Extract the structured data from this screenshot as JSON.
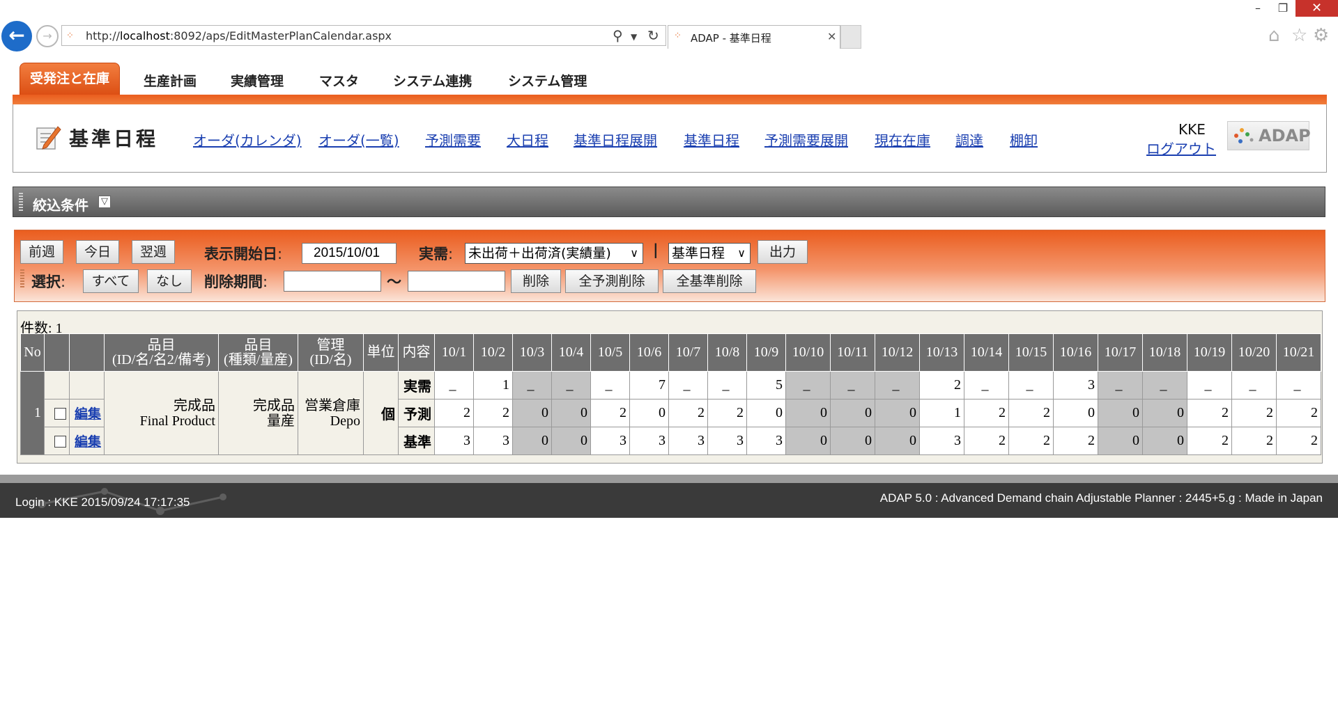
{
  "browser": {
    "url_prefix": "http://",
    "url_host": "localhost",
    "url_path": ":8092/aps/EditMasterPlanCalendar.aspx",
    "tab_title": "ADAP - 基準日程",
    "window_minimize": "–",
    "window_maximize": "❐",
    "window_close": "✕"
  },
  "menu": {
    "active": "受発注と在庫",
    "items": [
      "生産計画",
      "実績管理",
      "マスタ",
      "システム連携",
      "システム管理"
    ]
  },
  "header": {
    "page_title": "基準日程",
    "links": [
      "オーダ(カレンダ)",
      "オーダ(一覧)",
      "予測需要",
      "大日程",
      "基準日程展開",
      "基準日程",
      "予測需要展開",
      "現在在庫",
      "調達",
      "棚卸"
    ],
    "user": "KKE",
    "logout": "ログアウト",
    "logo": "ADAP"
  },
  "filter": {
    "title": "絞込条件",
    "toggle": "▽"
  },
  "controls": {
    "prev_week": "前週",
    "today": "今日",
    "next_week": "翌週",
    "start_date_label": "表示開始日",
    "start_date": "2015/10/01",
    "actual_label": "実需",
    "actual_select": "未出荷＋出荷済(実績量)",
    "separator": "|",
    "type_select": "基準日程",
    "output": "出力",
    "select_label": "選択",
    "select_all": "すべて",
    "select_none": "なし",
    "delete_period_label": "削除期間",
    "delete_from": "",
    "range_sep": "〜",
    "delete_to": "",
    "delete": "削除",
    "delete_all_forecast": "全予測削除",
    "delete_all_master": "全基準削除",
    "colon": ":"
  },
  "result": {
    "count_label": "件数",
    "count": "1",
    "headers": {
      "no": "No",
      "item_top": "品目",
      "item_sub": "(ID/名/名2/備考)",
      "item2_top": "品目",
      "item2_sub": "(種類/量産)",
      "mgmt_top": "管理",
      "mgmt_sub": "(ID/名)",
      "unit": "単位",
      "content": "内容"
    },
    "dates": [
      "10/1",
      "10/2",
      "10/3",
      "10/4",
      "10/5",
      "10/6",
      "10/7",
      "10/8",
      "10/9",
      "10/10",
      "10/11",
      "10/12",
      "10/13",
      "10/14",
      "10/15",
      "10/16",
      "10/17",
      "10/18",
      "10/19",
      "10/20",
      "10/21"
    ],
    "weekend": [
      false,
      false,
      true,
      true,
      false,
      false,
      false,
      false,
      false,
      true,
      true,
      true,
      false,
      false,
      false,
      false,
      true,
      true,
      false,
      false,
      false
    ],
    "row": {
      "no": "1",
      "edit": "編集",
      "item_name": "完成品",
      "item_name_en": "Final Product",
      "item_kind": "完成品",
      "item_mass": "量産",
      "mgmt_name": "営業倉庫",
      "mgmt_name_en": "Depo",
      "unit": "個",
      "kinds": [
        "実需",
        "予測",
        "基準"
      ],
      "actual": [
        "_",
        "1",
        "_",
        "_",
        "_",
        "7",
        "_",
        "_",
        "5",
        "_",
        "_",
        "_",
        "2",
        "_",
        "_",
        "3",
        "_",
        "_",
        "_",
        "_",
        "_"
      ],
      "forecast": [
        "2",
        "2",
        "0",
        "0",
        "2",
        "0",
        "2",
        "2",
        "0",
        "0",
        "0",
        "0",
        "1",
        "2",
        "2",
        "0",
        "0",
        "0",
        "2",
        "2",
        "2"
      ],
      "master": [
        "3",
        "3",
        "0",
        "0",
        "3",
        "3",
        "3",
        "3",
        "3",
        "0",
        "0",
        "0",
        "3",
        "2",
        "2",
        "2",
        "0",
        "0",
        "2",
        "2",
        "2"
      ]
    }
  },
  "footer": {
    "login": "Login : KKE 2015/09/24 17:17:35",
    "product": "ADAP 5.0 : Advanced Demand chain Adjustable Planner : 2445+5.g : Made in Japan"
  }
}
